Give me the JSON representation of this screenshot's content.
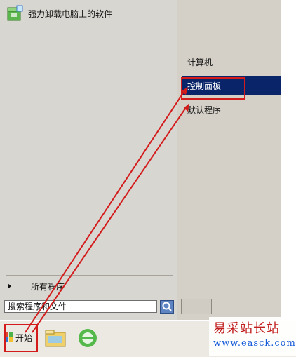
{
  "start_menu": {
    "pinned": [
      {
        "label": "强力卸载电脑上的软件",
        "icon": "uninstaller-icon"
      }
    ],
    "all_programs_label": "所有程序",
    "search_placeholder": "搜索程序和文件",
    "right_items": [
      {
        "label": "计算机"
      },
      {
        "label": "控制面板"
      },
      {
        "label": "默认程序"
      }
    ]
  },
  "taskbar": {
    "start_label": "开始"
  },
  "watermark": {
    "main": "易采站长站",
    "url": "www.easck.com"
  },
  "colors": {
    "selection": "#0a246a",
    "annotation": "#d31b1b",
    "watermark_red": "#c01717",
    "watermark_blue": "#0d55d9"
  }
}
